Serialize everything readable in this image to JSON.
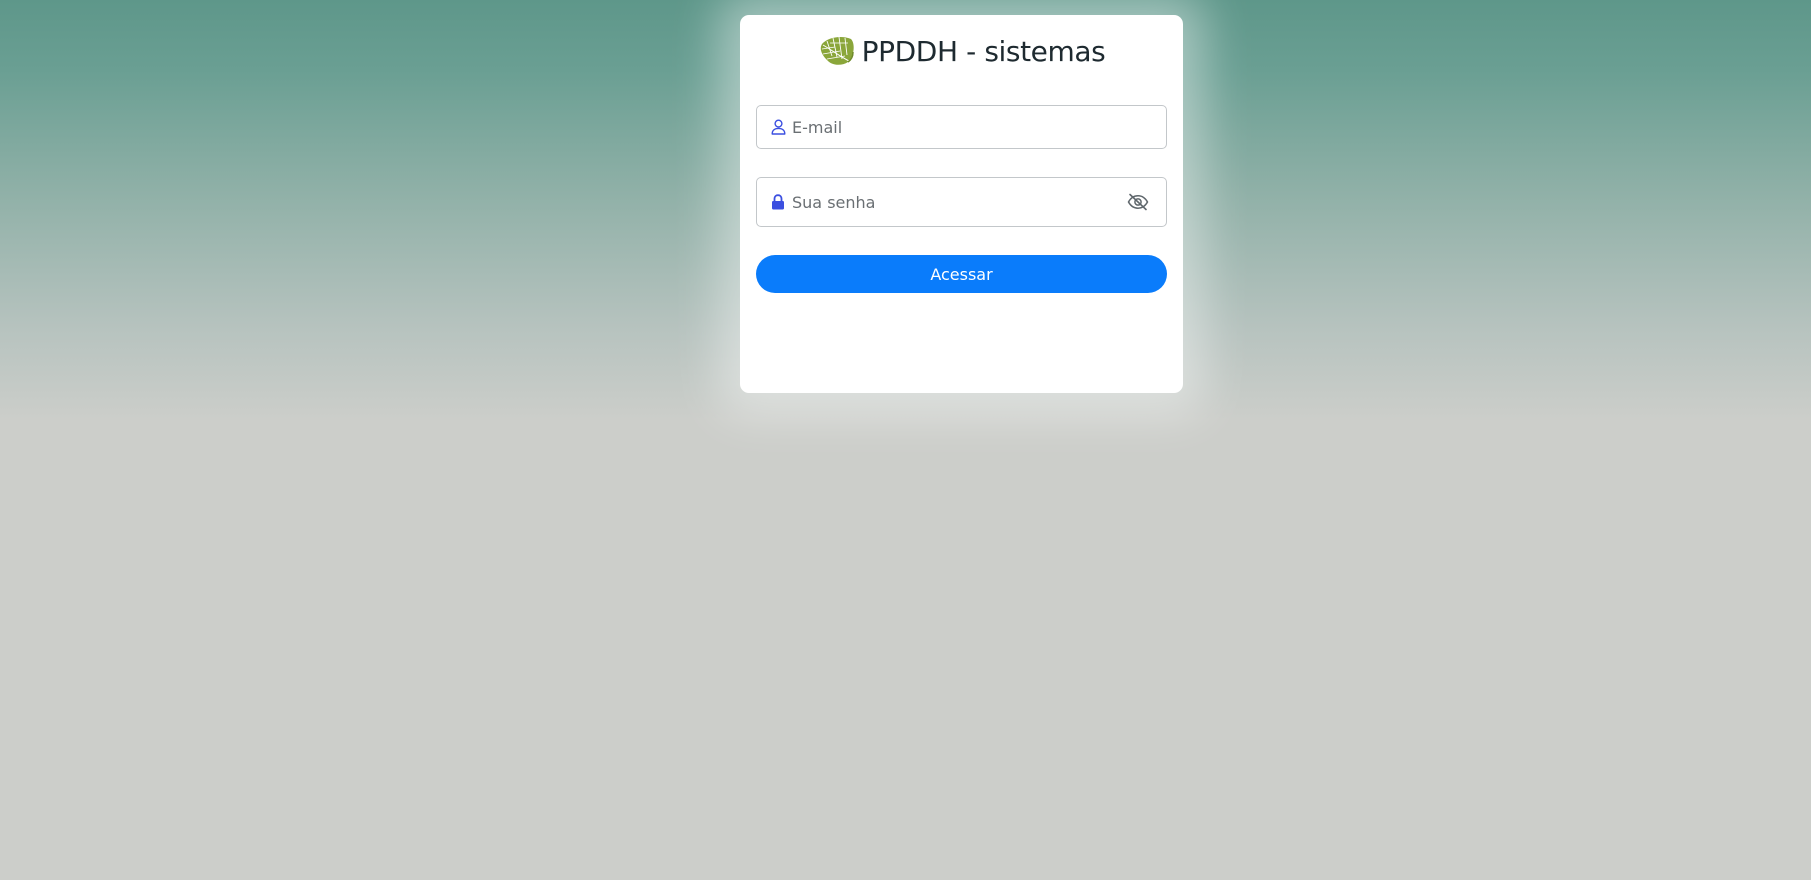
{
  "brand": {
    "title": "PPDDH - sistemas",
    "logo_icon": "leaf-logo-icon",
    "logo_color": "#8aa63a"
  },
  "login_form": {
    "email": {
      "placeholder": "E-mail",
      "value": "",
      "icon": "user-icon"
    },
    "password": {
      "placeholder": "Sua senha",
      "value": "",
      "icon": "lock-icon",
      "toggle_icon": "eye-slash-icon"
    },
    "submit_label": "Acessar"
  },
  "colors": {
    "accent": "#0a7cfb",
    "icon_blue": "#3b4fe0",
    "background_top": "#5e978a",
    "background_bottom": "#ccceca"
  }
}
